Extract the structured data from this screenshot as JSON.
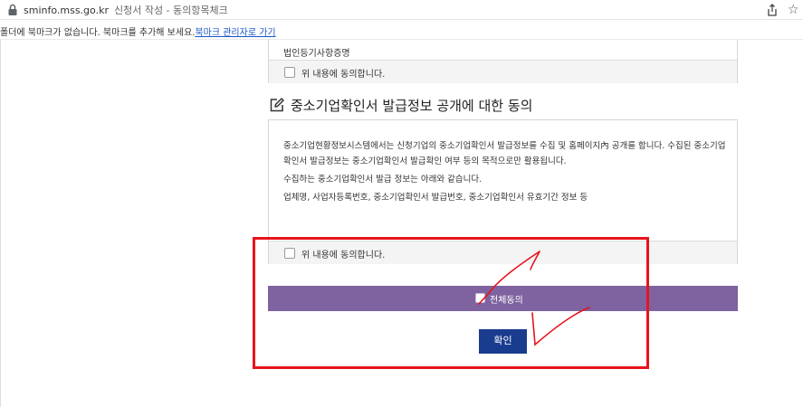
{
  "browser": {
    "url": "sminfo.mss.go.kr",
    "title": "신청서 작성 - 동의항목체크",
    "icons": [
      "lock-icon",
      "share-icon",
      "star-icon"
    ]
  },
  "bookmarks": {
    "message": "폴더에 북마크가 없습니다. 북마크를 추가해 보세요.",
    "manager_link": "북마크 관리자로 가기"
  },
  "previous_section": {
    "document": "법인등기사항증명",
    "agree_label": "위 내용에 동의합니다.",
    "checked": false
  },
  "disclosure_section": {
    "title": "중소기업확인서 발급정보 공개에 대한 동의",
    "paragraph1": "중소기업현황정보시스템에서는 신청기업의 중소기업확인서 발급정보를 수집 및 홈페이지內 공개를 합니다. 수집된 중소기업확인서 발급정보는 중소기업확인서 발급확인 여부 등의 목적으로만 활용됩니다.",
    "paragraph2": "수집하는 중소기업확인서 발급 정보는 아래와 같습니다.",
    "paragraph3": "업체명, 사업자등록번호, 중소기업확인서 발급번호, 중소기업확인서 유효기간 정보 등",
    "agree_label": "위 내용에 동의합니다.",
    "checked": false
  },
  "all_agree": {
    "label": "전체동의",
    "checked": false
  },
  "confirm_button": "확인",
  "colors": {
    "all_agree_bar": "#7e63a0",
    "confirm_button": "#1a3c8f",
    "annotation": "#e8141c"
  }
}
